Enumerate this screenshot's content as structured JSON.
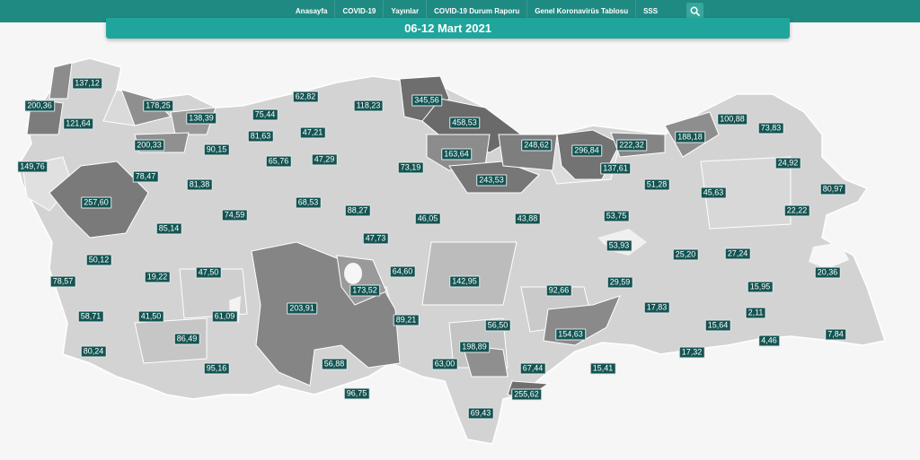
{
  "nav": {
    "items": [
      "Anasayfa",
      "COVID-19",
      "Yayınlar",
      "COVID-19 Durum Raporu",
      "Genel Koronavirüs Tablosu",
      "SSS"
    ],
    "search_icon": "search-icon"
  },
  "title": "06-12 Mart 2021",
  "colors": {
    "nav_bg": "#1f8a82",
    "title_bg": "#1fa59b",
    "label_bg": "#135452",
    "region_light": "#d3d3d3",
    "region_mid": "#b8b8b8",
    "region_dark": "#848484",
    "border": "#ffffff",
    "page_bg": "#f6f6f6"
  },
  "values": [
    "137,12",
    "200,36",
    "121,64",
    "178,25",
    "149,76",
    "200,33",
    "138,39",
    "75,44",
    "62,82",
    "118,23",
    "345,56",
    "458,53",
    "90,15",
    "81,63",
    "47,21",
    "78,47",
    "65,76",
    "163,64",
    "248,62",
    "296,84",
    "222,32",
    "188,18",
    "100,88",
    "73,83",
    "257,60",
    "81,38",
    "47,29",
    "73,19",
    "243,53",
    "137,61",
    "51,28",
    "24,92",
    "45,63",
    "80,97",
    "74,59",
    "68,53",
    "88,27",
    "46,05",
    "43,88",
    "53,75",
    "22,22",
    "85,14",
    "47,73",
    "53,93",
    "50,12",
    "64,60",
    "25,20",
    "27,24",
    "20,36",
    "19,22",
    "47,50",
    "173,52",
    "142,95",
    "92,66",
    "29,59",
    "78,57",
    "15,95",
    "203,91",
    "17,83",
    "2,11",
    "58,71",
    "41,50",
    "61,09",
    "89,21",
    "56,50",
    "154,63",
    "15,64",
    "86,49",
    "198,89",
    "4,46",
    "7,84",
    "80,24",
    "17,32",
    "95,16",
    "56,88",
    "63,00",
    "67,44",
    "15,41",
    "96,75",
    "255,62",
    "69,43"
  ]
}
